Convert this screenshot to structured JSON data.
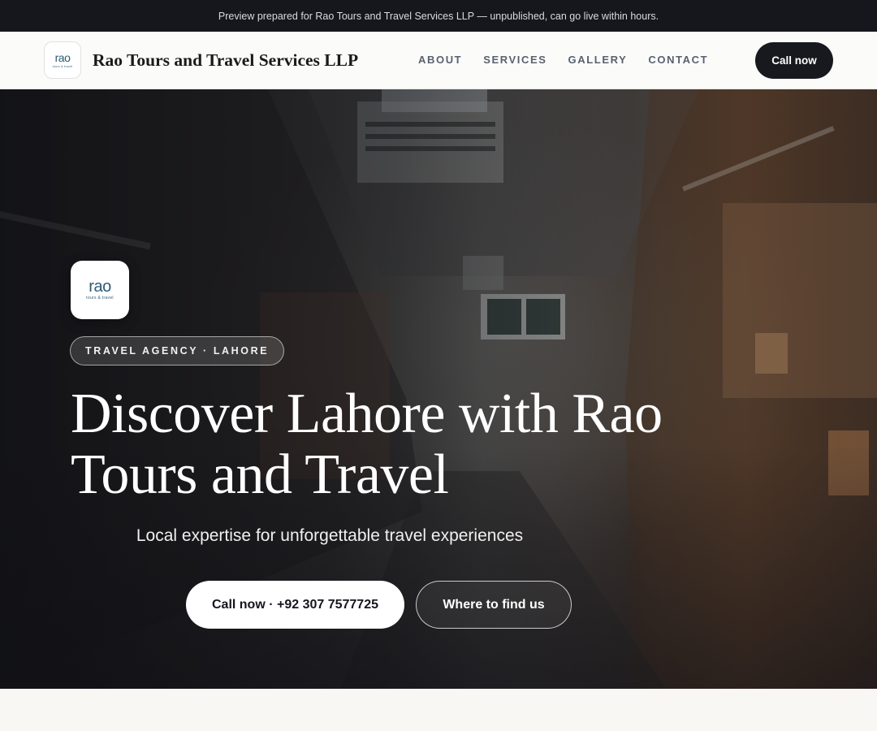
{
  "preview_banner": "Preview prepared for Rao Tours and Travel Services LLP — unpublished, can go live within hours.",
  "brand": {
    "name": "Rao Tours and Travel Services LLP",
    "logo_word": "rao",
    "logo_tagline": "tours & travel"
  },
  "nav": {
    "links": [
      "ABOUT",
      "SERVICES",
      "GALLERY",
      "CONTACT"
    ],
    "cta": "Call now"
  },
  "hero": {
    "eyebrow": "TRAVEL AGENCY · LAHORE",
    "headline": "Discover Lahore with Rao Tours and Travel",
    "subline": "Local expertise for unforgettable travel experiences",
    "primary_button": "Call now · +92 307 7577725",
    "secondary_button": "Where to find us"
  },
  "colors": {
    "dark": "#15171c",
    "logo_teal": "#2c5b73",
    "page_bg": "#f8f7f4"
  }
}
